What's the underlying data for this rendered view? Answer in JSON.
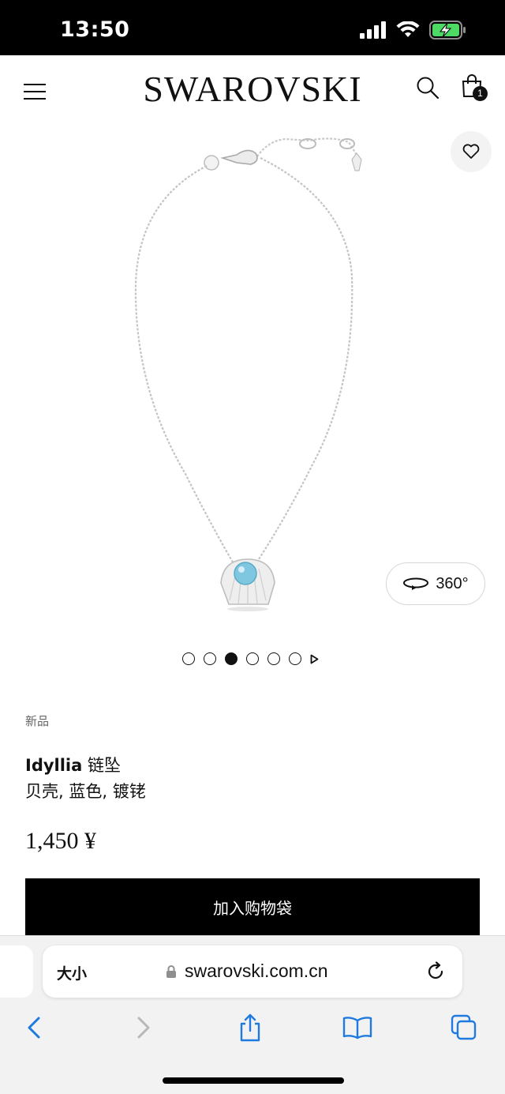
{
  "status_bar": {
    "time": "13:50"
  },
  "header": {
    "brand": "SWAROVSKI",
    "bag_count": "1"
  },
  "gallery": {
    "view360_label": "360°",
    "dots_count": 6,
    "active_dot_index": 2
  },
  "product": {
    "badge": "新品",
    "name": "Idyllia",
    "type": "链坠",
    "details": "贝壳, 蓝色, 镀铑",
    "price": "1,450 ¥",
    "add_to_bag": "加入购物袋"
  },
  "browser": {
    "text_size_label": "大小",
    "url": "swarovski.com.cn"
  },
  "colors": {
    "accent": "#000000",
    "ios_blue": "#1f7ae0",
    "battery_green": "#4cd964",
    "gem_blue": "#7fc6e0"
  }
}
